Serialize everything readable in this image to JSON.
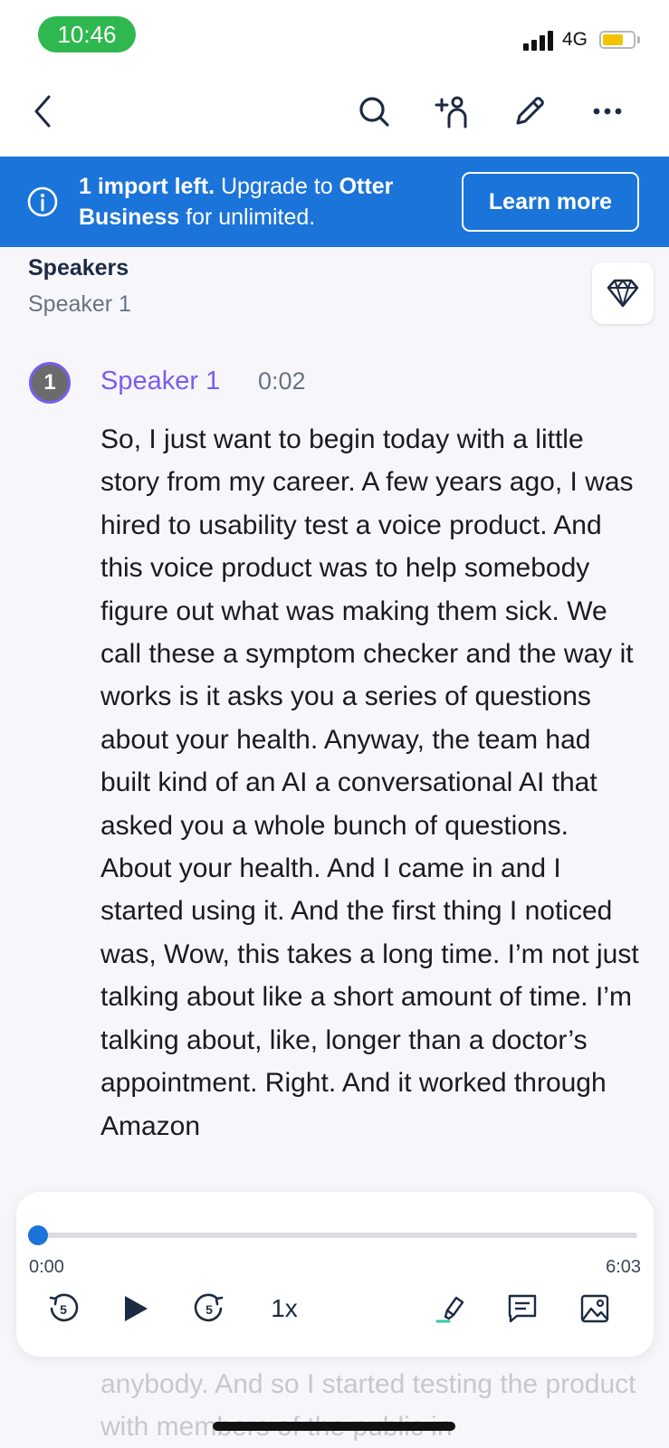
{
  "status_bar": {
    "time": "10:46",
    "network": "4G",
    "signal_bars": 4,
    "battery_level": 0.7,
    "battery_color": "#f2c400",
    "time_pill_color": "#2fb84f"
  },
  "nav": {
    "back_icon": "chevron-left-icon",
    "search_icon": "search-icon",
    "add_person_icon": "add-person-icon",
    "edit_icon": "pencil-icon",
    "more_icon": "more-dots-icon"
  },
  "banner": {
    "bold_lead": "1 import left.",
    "text_mid": " Upgrade to ",
    "bold_brand": "Otter Business",
    "text_end": " for unlimited.",
    "button_label": "Learn more",
    "color": "#1b74d9"
  },
  "speakers": {
    "title": "Speakers",
    "list": "Speaker 1",
    "premium_icon": "diamond-icon"
  },
  "transcript": {
    "avatar_number": "1",
    "speaker_name": "Speaker 1",
    "timestamp": "0:02",
    "text": "So, I just want to begin today with a little story from my career. A few years ago, I was hired to usability test a voice product. And this voice product was to help somebody figure out what was making them sick. We call these a symptom checker and the way it works is it asks you a series of questions about your health. Anyway, the team had built kind of an AI a conversational AI that asked you a whole bunch of questions. About your health. And I came in and I started using it. And the first thing I noticed was, Wow, this takes a long time. I’m not just talking about like a short amount of time. I’m talking about, like, longer than a doctor’s appointment. Right. And it worked through Amazon",
    "faded_text": "anybody. And so I started testing the product with members of the public in",
    "accent_color": "#7a5cf2"
  },
  "player": {
    "current_time": "0:00",
    "total_time": "6:03",
    "progress": 0.0,
    "speed": "1x",
    "rewind_icon": "rewind-5-icon",
    "play_icon": "play-icon",
    "forward_icon": "forward-5-icon",
    "highlight_icon": "highlighter-icon",
    "comment_icon": "comment-icon",
    "image_icon": "image-icon"
  }
}
